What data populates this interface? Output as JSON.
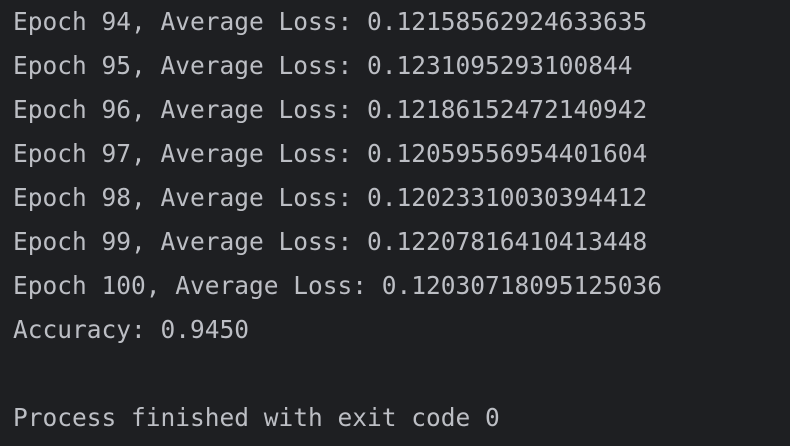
{
  "console": {
    "lines": [
      "Epoch 94, Average Loss: 0.12158562924633635",
      "Epoch 95, Average Loss: 0.1231095293100844",
      "Epoch 96, Average Loss: 0.12186152472140942",
      "Epoch 97, Average Loss: 0.12059556954401604",
      "Epoch 98, Average Loss: 0.12023310030394412",
      "Epoch 99, Average Loss: 0.12207816410413448",
      "Epoch 100, Average Loss: 0.12030718095125036",
      "Accuracy: 0.9450",
      "",
      "Process finished with exit code 0"
    ],
    "background_color": "#1e1f22",
    "text_color": "#bcbec4"
  }
}
